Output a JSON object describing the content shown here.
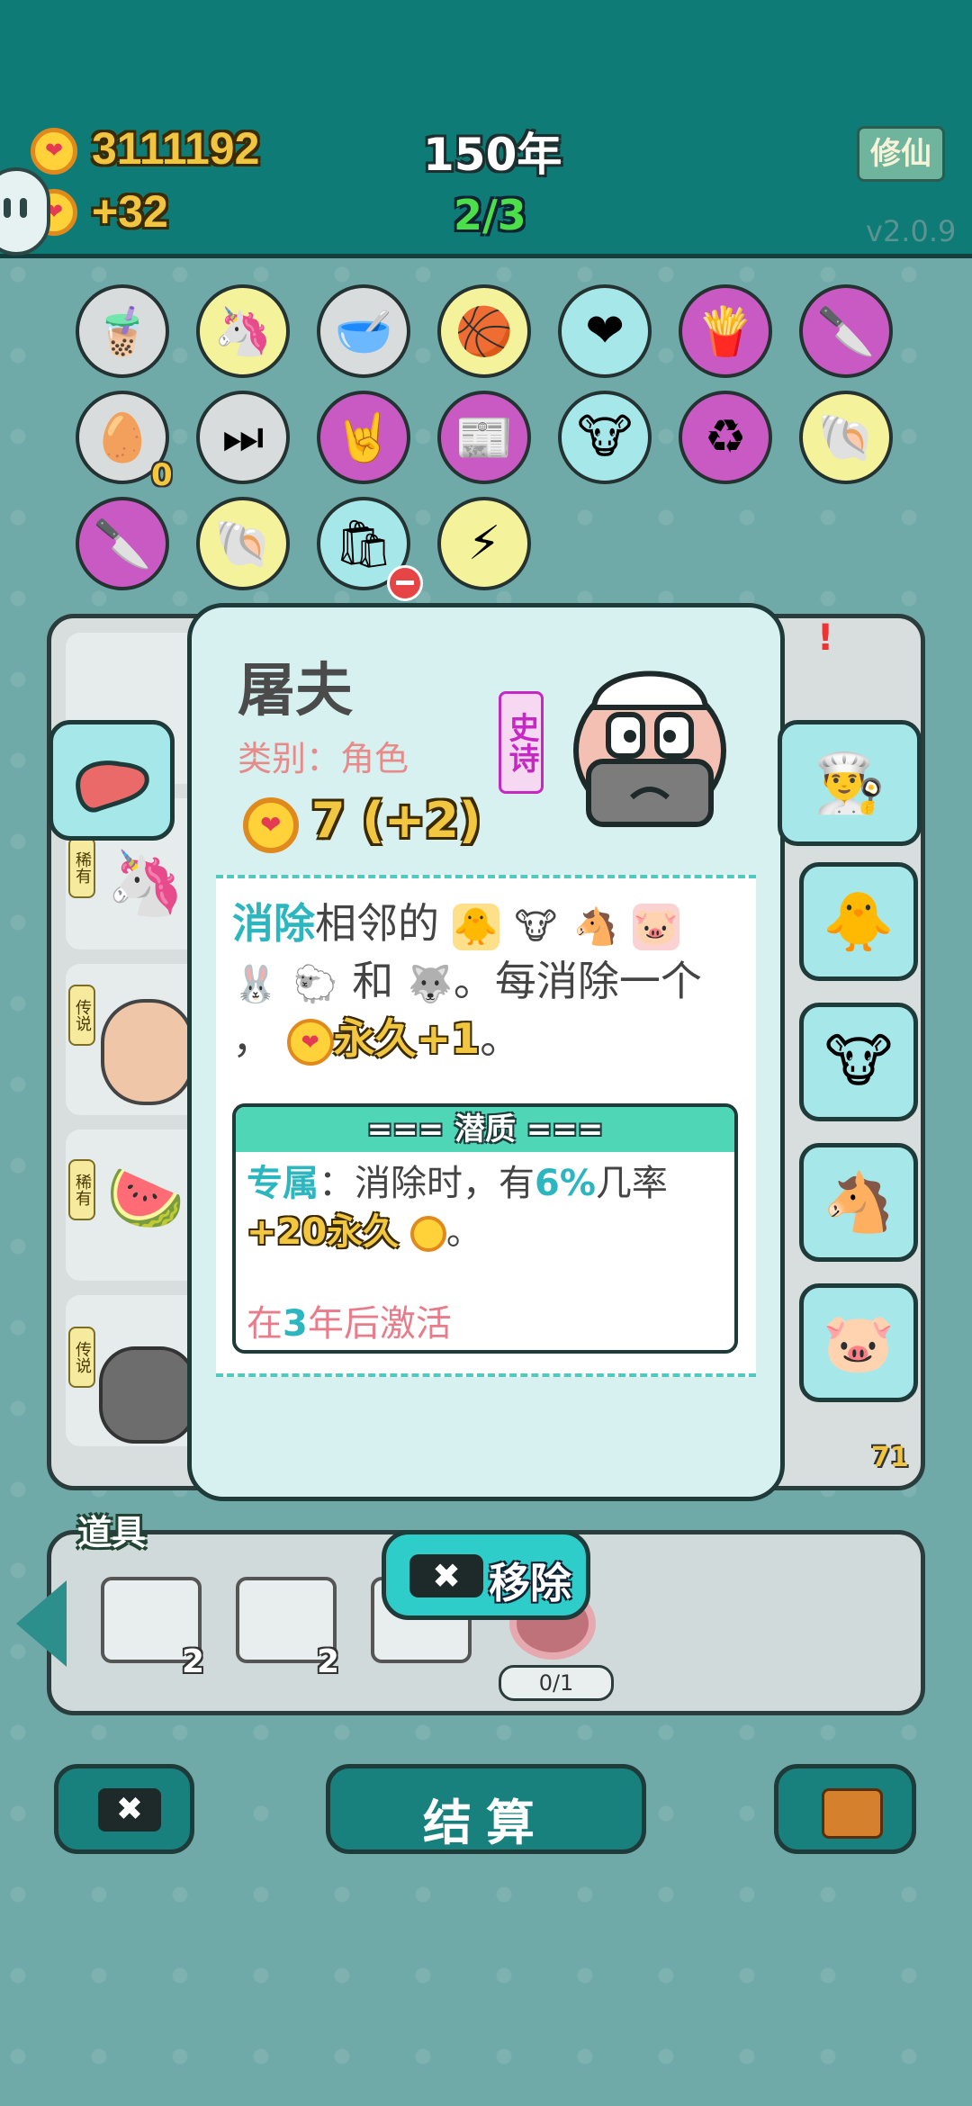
{
  "header": {
    "coins": "3111192",
    "income": "+32",
    "year": "150年",
    "round": "2/3",
    "cultivation_button": "修仙",
    "version": "v2.0.9"
  },
  "inventory": {
    "items": [
      {
        "icon": "bubble-tea-icon",
        "bg": "#d9dcdc"
      },
      {
        "icon": "unicorn-icon",
        "bg": "#f4f29b"
      },
      {
        "icon": "pet-bowl-icon",
        "bg": "#d9dcdc"
      },
      {
        "icon": "basketballs-icon",
        "bg": "#f4f29b"
      },
      {
        "icon": "heart-fan-icon",
        "bg": "#a6e8ea"
      },
      {
        "icon": "fries-icon",
        "bg": "#c95ac3"
      },
      {
        "icon": "cleaver-icon",
        "bg": "#c95ac3"
      },
      {
        "icon": "egg-carton-icon",
        "bg": "#d9dcdc"
      },
      {
        "icon": "skip-icon",
        "bg": "#d9dcdc"
      },
      {
        "icon": "rock-hand-icon",
        "bg": "#c95ac3"
      },
      {
        "icon": "time-magazine-icon",
        "bg": "#c95ac3"
      },
      {
        "icon": "cow-pair-icon",
        "bg": "#a6e8ea"
      },
      {
        "icon": "recycle-icon",
        "bg": "#c95ac3"
      },
      {
        "icon": "shell-icon",
        "bg": "#f4f29b"
      },
      {
        "icon": "cleaver-icon",
        "bg": "#c95ac3"
      },
      {
        "icon": "shell-icon",
        "bg": "#f4f29b"
      },
      {
        "icon": "trash-bag-icon",
        "bg": "#a6e8ea"
      },
      {
        "icon": "lightning-icon",
        "bg": "#f4f29b"
      }
    ],
    "egg_count": "0"
  },
  "board": {
    "tags": [
      "稀有",
      "传说",
      "稀有",
      "传说"
    ],
    "counter": "71"
  },
  "modal": {
    "name": "屠夫",
    "category": "类别：角色",
    "rarity": "史诗",
    "value": "7 (+2)",
    "desc_eliminate": "消除",
    "desc_text1": "相邻的",
    "desc_and": "和",
    "desc_text2": "。每消除一个",
    "desc_comma": "，",
    "desc_perm": "永久+1",
    "desc_end": "。",
    "potential_title": "=== 潜质 ===",
    "potential_label": "专属",
    "potential_text1": "：消除时，有",
    "potential_pct": "6%",
    "potential_text2": "几率",
    "potential_bonus": "+20永久",
    "potential_end": "。",
    "activate_pre": "在",
    "activate_num": "3",
    "activate_post": "年后激活"
  },
  "side_cards": [
    "butcher-icon",
    "chick-icon",
    "cow-icon",
    "horse-icon",
    "pig-icon"
  ],
  "tools": {
    "title": "道具",
    "counts": [
      "2",
      "2"
    ],
    "remove_label": "移除",
    "target_count": "0/1"
  },
  "bottom": {
    "settle_label": "结算"
  }
}
